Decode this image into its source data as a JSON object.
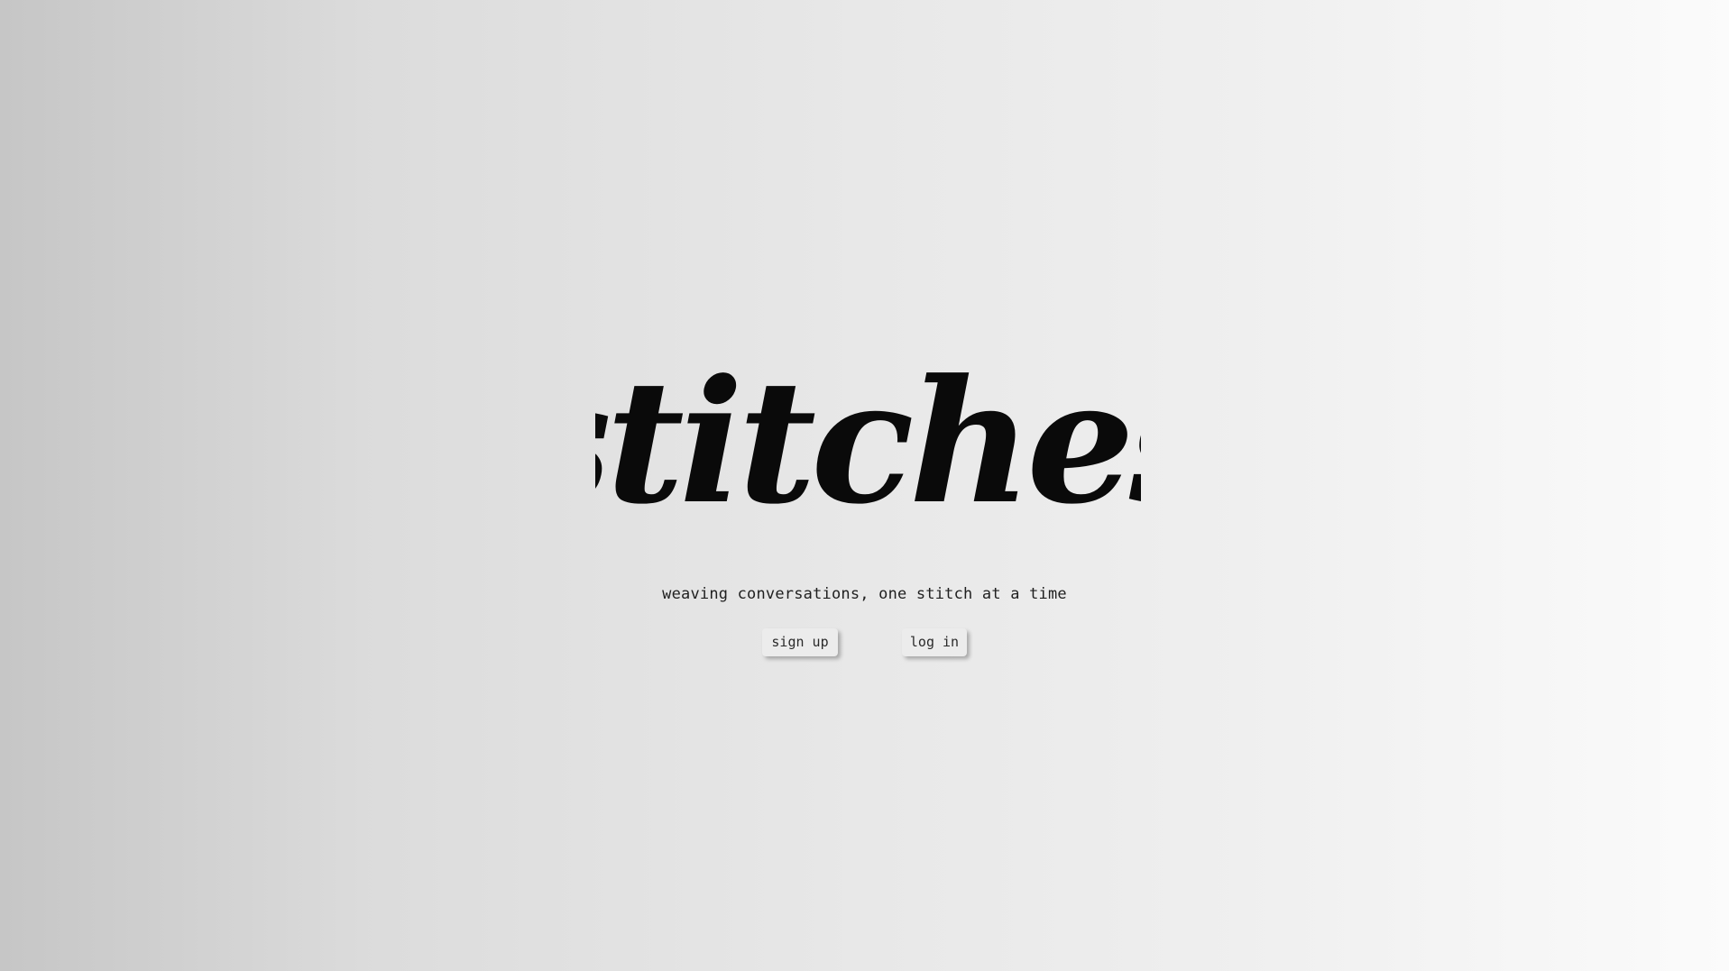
{
  "brand": {
    "logo_text": "stitches"
  },
  "tagline": "weaving conversations, one stitch at a time",
  "actions": {
    "sign_up_label": "sign up",
    "log_in_label": "log in"
  },
  "colors": {
    "text": "#1b1b1b",
    "logo": "#0a0a0a",
    "button_background": "#ececec",
    "background_left": "#c6c6c6",
    "background_right": "#fbfbfb"
  }
}
